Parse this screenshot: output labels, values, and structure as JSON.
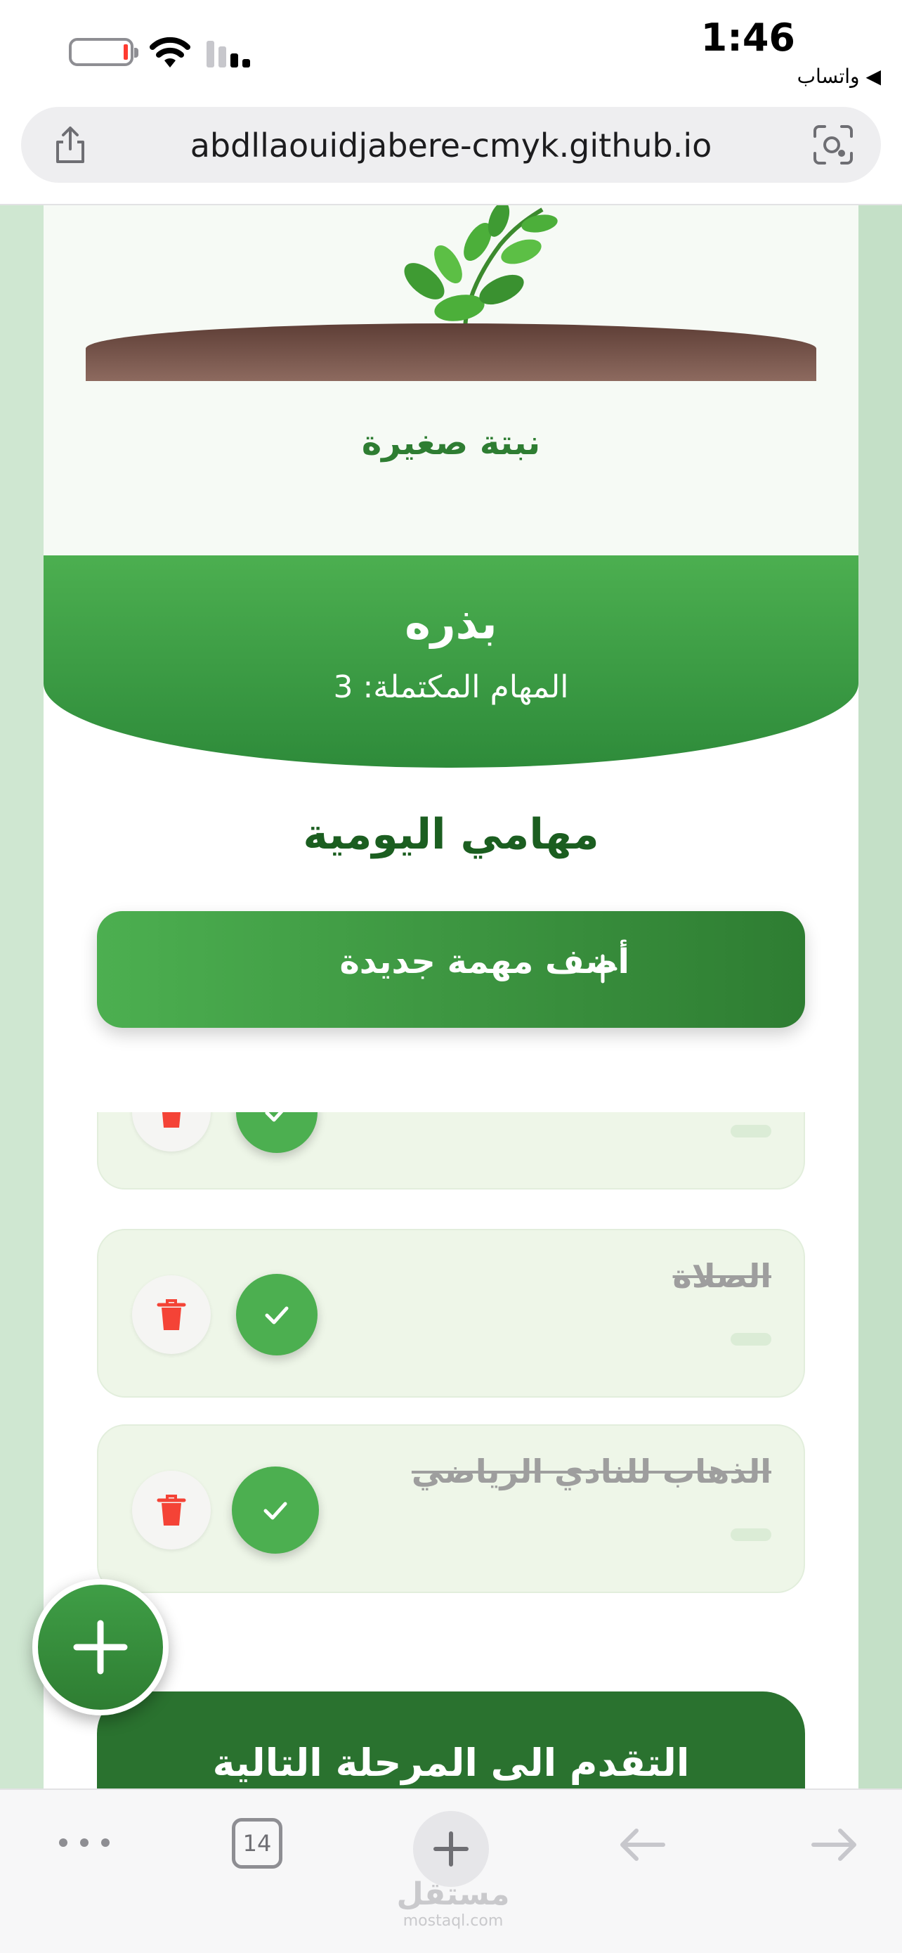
{
  "status_bar": {
    "time": "1:46",
    "back_app": "◀ واتساب",
    "battery_level": 0.1,
    "battery_color": "#ff3b30"
  },
  "browser": {
    "url": "abdllaouidjabere-cmyk.github.io",
    "share_icon": "share-icon",
    "lens_icon": "visual-lookup-icon",
    "tab_count": "14"
  },
  "plant": {
    "stage_name": "نبتة صغيرة"
  },
  "banner": {
    "title": "بذره",
    "completed_text": "المهام المكتملة: 3"
  },
  "tasks_section": {
    "title": "مهامي اليومية",
    "add_button_label": "أضف مهمة جديدة",
    "items": [
      {
        "title": "",
        "completed": true
      },
      {
        "title": "الصلاة",
        "completed": true
      },
      {
        "title": "الذهاب للنادي الرياضي",
        "completed": true
      }
    ]
  },
  "next_stage_button": {
    "label": "التقدم الى المرحلة التالية"
  },
  "watermark": {
    "arabic": "مستقل",
    "latin": "mostaql.com"
  },
  "colors": {
    "primary_green": "#4caf50",
    "dark_green": "#2e7d32",
    "delete_red": "#f44336"
  }
}
